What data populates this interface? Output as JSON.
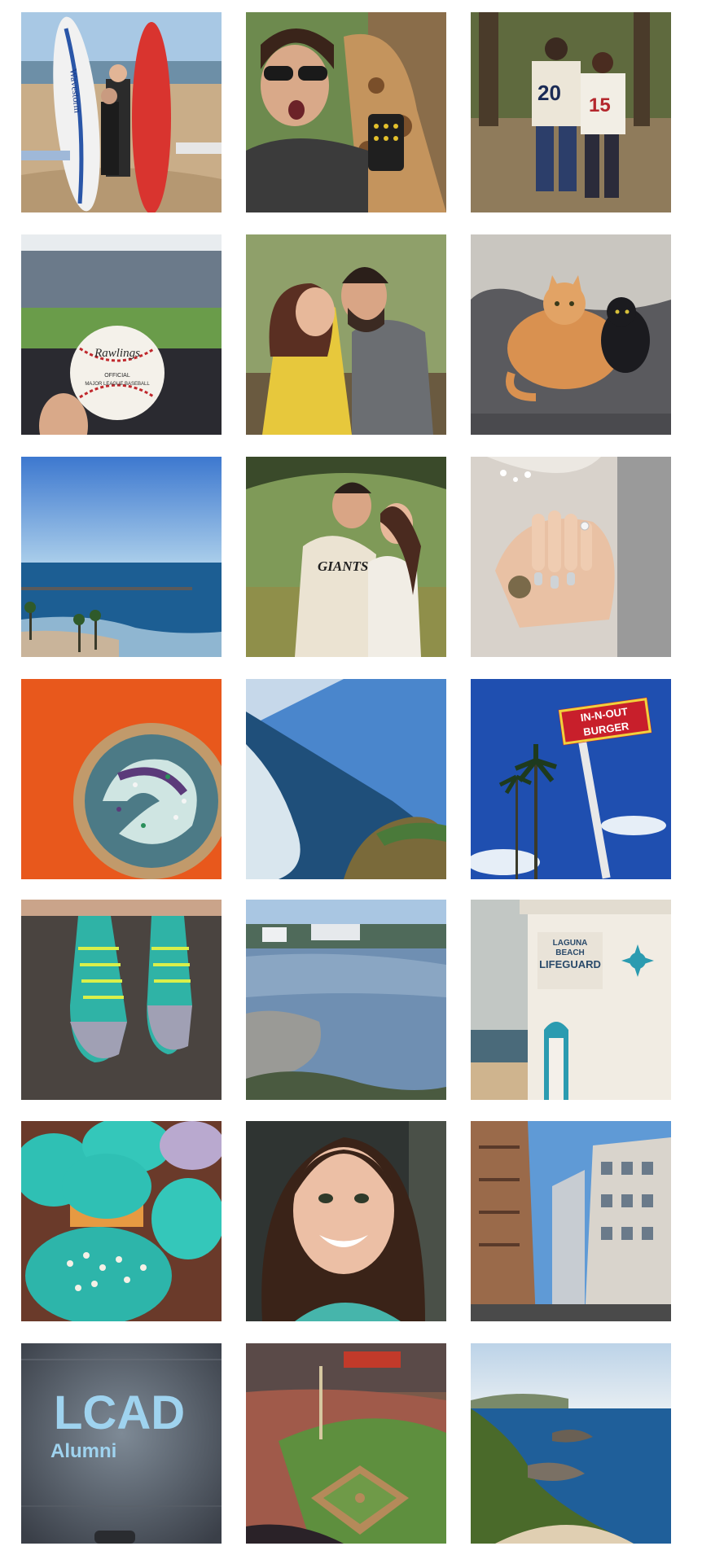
{
  "photo_text": {
    "surfboard_brand": "Wavestorm",
    "jersey_left_number": "20",
    "jersey_right_number": "15",
    "baseball_brand": "Rawlings",
    "baseball_official": "OFFICIAL",
    "baseball_league": "MAJOR LEAGUE BASEBALL",
    "jersey_team": "GIANTS",
    "burger_sign_line1": "IN-N-OUT",
    "burger_sign_line2": "BURGER",
    "lifeguard_line1": "LAGUNA",
    "lifeguard_line2": "BEACH",
    "lifeguard_line3": "LIFEGUARD",
    "lcad_logo": "LCAD",
    "lcad_sub": "Alumni"
  },
  "colors": {
    "background": "#ffffff",
    "orange": "#e8581c",
    "teal": "#2fc0b4",
    "sky": "#3f7fd0",
    "lcad_blue": "#9fd3ef"
  }
}
